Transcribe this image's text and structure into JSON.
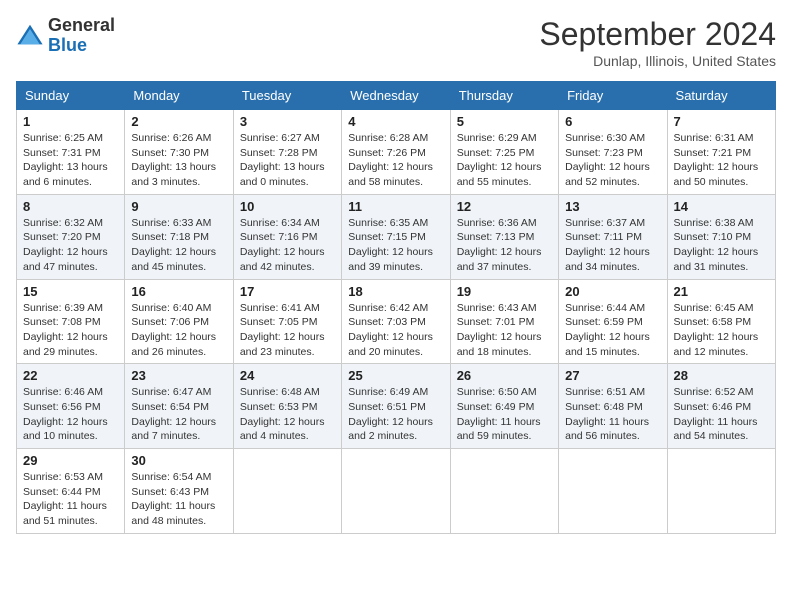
{
  "header": {
    "logo_general": "General",
    "logo_blue": "Blue",
    "month_title": "September 2024",
    "location": "Dunlap, Illinois, United States"
  },
  "days_of_week": [
    "Sunday",
    "Monday",
    "Tuesday",
    "Wednesday",
    "Thursday",
    "Friday",
    "Saturday"
  ],
  "weeks": [
    [
      {
        "day": "1",
        "sunrise": "6:25 AM",
        "sunset": "7:31 PM",
        "daylight": "13 hours and 6 minutes."
      },
      {
        "day": "2",
        "sunrise": "6:26 AM",
        "sunset": "7:30 PM",
        "daylight": "13 hours and 3 minutes."
      },
      {
        "day": "3",
        "sunrise": "6:27 AM",
        "sunset": "7:28 PM",
        "daylight": "13 hours and 0 minutes."
      },
      {
        "day": "4",
        "sunrise": "6:28 AM",
        "sunset": "7:26 PM",
        "daylight": "12 hours and 58 minutes."
      },
      {
        "day": "5",
        "sunrise": "6:29 AM",
        "sunset": "7:25 PM",
        "daylight": "12 hours and 55 minutes."
      },
      {
        "day": "6",
        "sunrise": "6:30 AM",
        "sunset": "7:23 PM",
        "daylight": "12 hours and 52 minutes."
      },
      {
        "day": "7",
        "sunrise": "6:31 AM",
        "sunset": "7:21 PM",
        "daylight": "12 hours and 50 minutes."
      }
    ],
    [
      {
        "day": "8",
        "sunrise": "6:32 AM",
        "sunset": "7:20 PM",
        "daylight": "12 hours and 47 minutes."
      },
      {
        "day": "9",
        "sunrise": "6:33 AM",
        "sunset": "7:18 PM",
        "daylight": "12 hours and 45 minutes."
      },
      {
        "day": "10",
        "sunrise": "6:34 AM",
        "sunset": "7:16 PM",
        "daylight": "12 hours and 42 minutes."
      },
      {
        "day": "11",
        "sunrise": "6:35 AM",
        "sunset": "7:15 PM",
        "daylight": "12 hours and 39 minutes."
      },
      {
        "day": "12",
        "sunrise": "6:36 AM",
        "sunset": "7:13 PM",
        "daylight": "12 hours and 37 minutes."
      },
      {
        "day": "13",
        "sunrise": "6:37 AM",
        "sunset": "7:11 PM",
        "daylight": "12 hours and 34 minutes."
      },
      {
        "day": "14",
        "sunrise": "6:38 AM",
        "sunset": "7:10 PM",
        "daylight": "12 hours and 31 minutes."
      }
    ],
    [
      {
        "day": "15",
        "sunrise": "6:39 AM",
        "sunset": "7:08 PM",
        "daylight": "12 hours and 29 minutes."
      },
      {
        "day": "16",
        "sunrise": "6:40 AM",
        "sunset": "7:06 PM",
        "daylight": "12 hours and 26 minutes."
      },
      {
        "day": "17",
        "sunrise": "6:41 AM",
        "sunset": "7:05 PM",
        "daylight": "12 hours and 23 minutes."
      },
      {
        "day": "18",
        "sunrise": "6:42 AM",
        "sunset": "7:03 PM",
        "daylight": "12 hours and 20 minutes."
      },
      {
        "day": "19",
        "sunrise": "6:43 AM",
        "sunset": "7:01 PM",
        "daylight": "12 hours and 18 minutes."
      },
      {
        "day": "20",
        "sunrise": "6:44 AM",
        "sunset": "6:59 PM",
        "daylight": "12 hours and 15 minutes."
      },
      {
        "day": "21",
        "sunrise": "6:45 AM",
        "sunset": "6:58 PM",
        "daylight": "12 hours and 12 minutes."
      }
    ],
    [
      {
        "day": "22",
        "sunrise": "6:46 AM",
        "sunset": "6:56 PM",
        "daylight": "12 hours and 10 minutes."
      },
      {
        "day": "23",
        "sunrise": "6:47 AM",
        "sunset": "6:54 PM",
        "daylight": "12 hours and 7 minutes."
      },
      {
        "day": "24",
        "sunrise": "6:48 AM",
        "sunset": "6:53 PM",
        "daylight": "12 hours and 4 minutes."
      },
      {
        "day": "25",
        "sunrise": "6:49 AM",
        "sunset": "6:51 PM",
        "daylight": "12 hours and 2 minutes."
      },
      {
        "day": "26",
        "sunrise": "6:50 AM",
        "sunset": "6:49 PM",
        "daylight": "11 hours and 59 minutes."
      },
      {
        "day": "27",
        "sunrise": "6:51 AM",
        "sunset": "6:48 PM",
        "daylight": "11 hours and 56 minutes."
      },
      {
        "day": "28",
        "sunrise": "6:52 AM",
        "sunset": "6:46 PM",
        "daylight": "11 hours and 54 minutes."
      }
    ],
    [
      {
        "day": "29",
        "sunrise": "6:53 AM",
        "sunset": "6:44 PM",
        "daylight": "11 hours and 51 minutes."
      },
      {
        "day": "30",
        "sunrise": "6:54 AM",
        "sunset": "6:43 PM",
        "daylight": "11 hours and 48 minutes."
      },
      null,
      null,
      null,
      null,
      null
    ]
  ],
  "labels": {
    "sunrise": "Sunrise:",
    "sunset": "Sunset:",
    "daylight": "Daylight:"
  }
}
